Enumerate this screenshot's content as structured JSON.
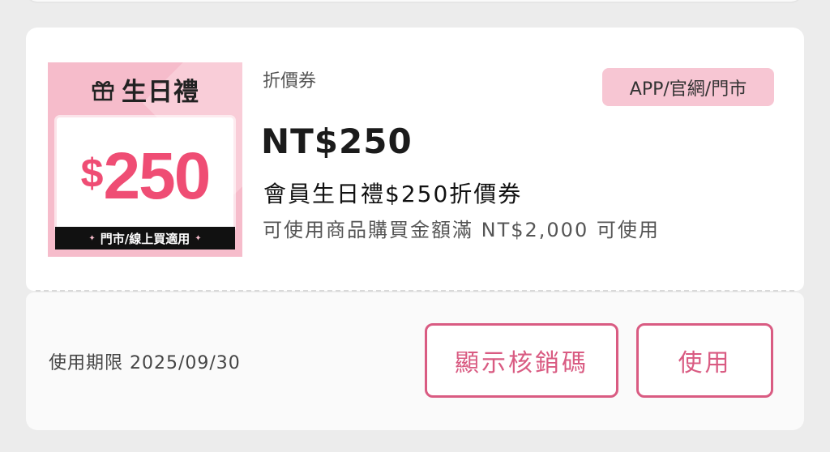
{
  "coupon": {
    "image": {
      "header_text": "生日禮",
      "currency_symbol": "$",
      "amount": "250",
      "strip_text": "門市/線上買適用",
      "strip_dot": "✦",
      "gift_icon": "gift-icon",
      "bg_color": "#f6bccb",
      "amount_color": "#ef4d74"
    },
    "type_label": "折價券",
    "channel_badge": "APP/官網/門市",
    "price": "NT$250",
    "name": "會員生日禮$250折價券",
    "condition": "可使用商品購買金額滿 NT$2,000 可使用"
  },
  "footer": {
    "expiry": "使用期限 2025/09/30",
    "show_code_button": "顯示核銷碼",
    "use_button": "使用"
  },
  "colors": {
    "accent": "#d95b82",
    "badge_bg": "#f7c6d3",
    "page_bg": "#ececec"
  }
}
